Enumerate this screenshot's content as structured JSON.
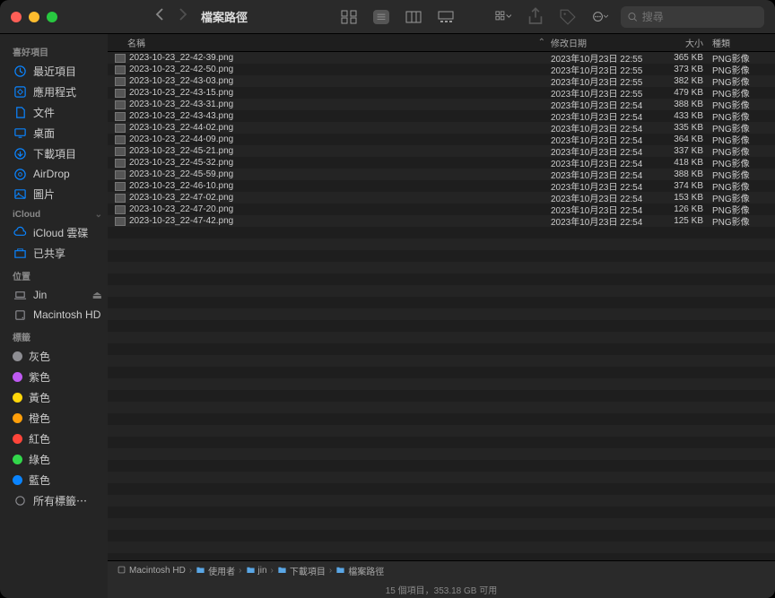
{
  "window": {
    "title": "檔案路徑"
  },
  "search": {
    "placeholder": "搜尋"
  },
  "sidebar": {
    "sections": [
      {
        "header": "喜好項目",
        "items": [
          {
            "icon": "clock",
            "label": "最近項目"
          },
          {
            "icon": "app",
            "label": "應用程式"
          },
          {
            "icon": "doc",
            "label": "文件"
          },
          {
            "icon": "desktop",
            "label": "桌面"
          },
          {
            "icon": "download",
            "label": "下載項目"
          },
          {
            "icon": "airdrop",
            "label": "AirDrop"
          },
          {
            "icon": "photo",
            "label": "圖片"
          }
        ]
      },
      {
        "header": "iCloud",
        "collapsible": true,
        "items": [
          {
            "icon": "cloud",
            "label": "iCloud 雲碟"
          },
          {
            "icon": "shared",
            "label": "已共享"
          }
        ]
      },
      {
        "header": "位置",
        "items": [
          {
            "icon": "laptop",
            "grey": true,
            "label": "Jin",
            "eject": true
          },
          {
            "icon": "hdd",
            "grey": true,
            "label": "Macintosh HD"
          }
        ]
      },
      {
        "header": "標籤",
        "items": [
          {
            "tag": "#8e8e93",
            "label": "灰色"
          },
          {
            "tag": "#bf5af2",
            "label": "紫色"
          },
          {
            "tag": "#ffd60a",
            "label": "黃色"
          },
          {
            "tag": "#ff9f0a",
            "label": "橙色"
          },
          {
            "tag": "#ff453a",
            "label": "紅色"
          },
          {
            "tag": "#32d74b",
            "label": "綠色"
          },
          {
            "tag": "#0a84ff",
            "label": "藍色"
          },
          {
            "icon": "alltags",
            "grey": true,
            "label": "所有標籤⋯"
          }
        ]
      }
    ]
  },
  "columns": {
    "name": "名稱",
    "date": "修改日期",
    "size": "大小",
    "kind": "種類"
  },
  "files": [
    {
      "name": "2023-10-23_22-42-39.png",
      "date": "2023年10月23日 22:55",
      "size": "365 KB",
      "kind": "PNG影像"
    },
    {
      "name": "2023-10-23_22-42-50.png",
      "date": "2023年10月23日 22:55",
      "size": "373 KB",
      "kind": "PNG影像"
    },
    {
      "name": "2023-10-23_22-43-03.png",
      "date": "2023年10月23日 22:55",
      "size": "382 KB",
      "kind": "PNG影像"
    },
    {
      "name": "2023-10-23_22-43-15.png",
      "date": "2023年10月23日 22:55",
      "size": "479 KB",
      "kind": "PNG影像"
    },
    {
      "name": "2023-10-23_22-43-31.png",
      "date": "2023年10月23日 22:54",
      "size": "388 KB",
      "kind": "PNG影像"
    },
    {
      "name": "2023-10-23_22-43-43.png",
      "date": "2023年10月23日 22:54",
      "size": "433 KB",
      "kind": "PNG影像"
    },
    {
      "name": "2023-10-23_22-44-02.png",
      "date": "2023年10月23日 22:54",
      "size": "335 KB",
      "kind": "PNG影像"
    },
    {
      "name": "2023-10-23_22-44-09.png",
      "date": "2023年10月23日 22:54",
      "size": "364 KB",
      "kind": "PNG影像"
    },
    {
      "name": "2023-10-23_22-45-21.png",
      "date": "2023年10月23日 22:54",
      "size": "337 KB",
      "kind": "PNG影像"
    },
    {
      "name": "2023-10-23_22-45-32.png",
      "date": "2023年10月23日 22:54",
      "size": "418 KB",
      "kind": "PNG影像"
    },
    {
      "name": "2023-10-23_22-45-59.png",
      "date": "2023年10月23日 22:54",
      "size": "388 KB",
      "kind": "PNG影像"
    },
    {
      "name": "2023-10-23_22-46-10.png",
      "date": "2023年10月23日 22:54",
      "size": "374 KB",
      "kind": "PNG影像"
    },
    {
      "name": "2023-10-23_22-47-02.png",
      "date": "2023年10月23日 22:54",
      "size": "153 KB",
      "kind": "PNG影像"
    },
    {
      "name": "2023-10-23_22-47-20.png",
      "date": "2023年10月23日 22:54",
      "size": "126 KB",
      "kind": "PNG影像"
    },
    {
      "name": "2023-10-23_22-47-42.png",
      "date": "2023年10月23日 22:54",
      "size": "125 KB",
      "kind": "PNG影像"
    }
  ],
  "pathbar": [
    "Macintosh HD",
    "使用者",
    "jin",
    "下載項目",
    "檔案路徑"
  ],
  "status": "15 個項目，353.18 GB 可用"
}
